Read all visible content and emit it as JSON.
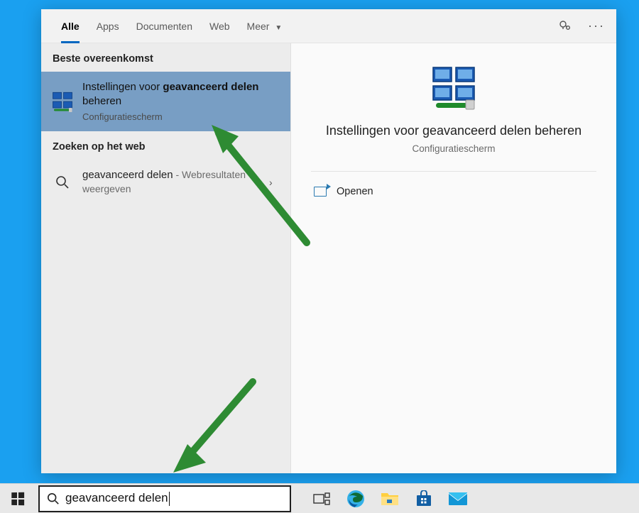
{
  "tabs": {
    "items": [
      {
        "label": "Alle",
        "active": true
      },
      {
        "label": "Apps"
      },
      {
        "label": "Documenten"
      },
      {
        "label": "Web"
      },
      {
        "label": "Meer",
        "dropdown": true
      }
    ]
  },
  "left": {
    "best_match_header": "Beste overeenkomst",
    "result_title_pre": "Instellingen voor ",
    "result_title_bold": "geavanceerd delen",
    "result_title_post": " beheren",
    "result_sub": "Configuratiescherm",
    "web_header": "Zoeken op het web",
    "web_query": "geavanceerd delen",
    "web_suffix": " - Webresultaten weergeven"
  },
  "detail": {
    "title": "Instellingen voor geavanceerd delen beheren",
    "sub": "Configuratiescherm",
    "open_label": "Openen"
  },
  "search": {
    "query": "geavanceerd delen"
  },
  "colors": {
    "accent": "#0067c0",
    "selection": "#789ec4",
    "arrow": "#2e8b33"
  }
}
